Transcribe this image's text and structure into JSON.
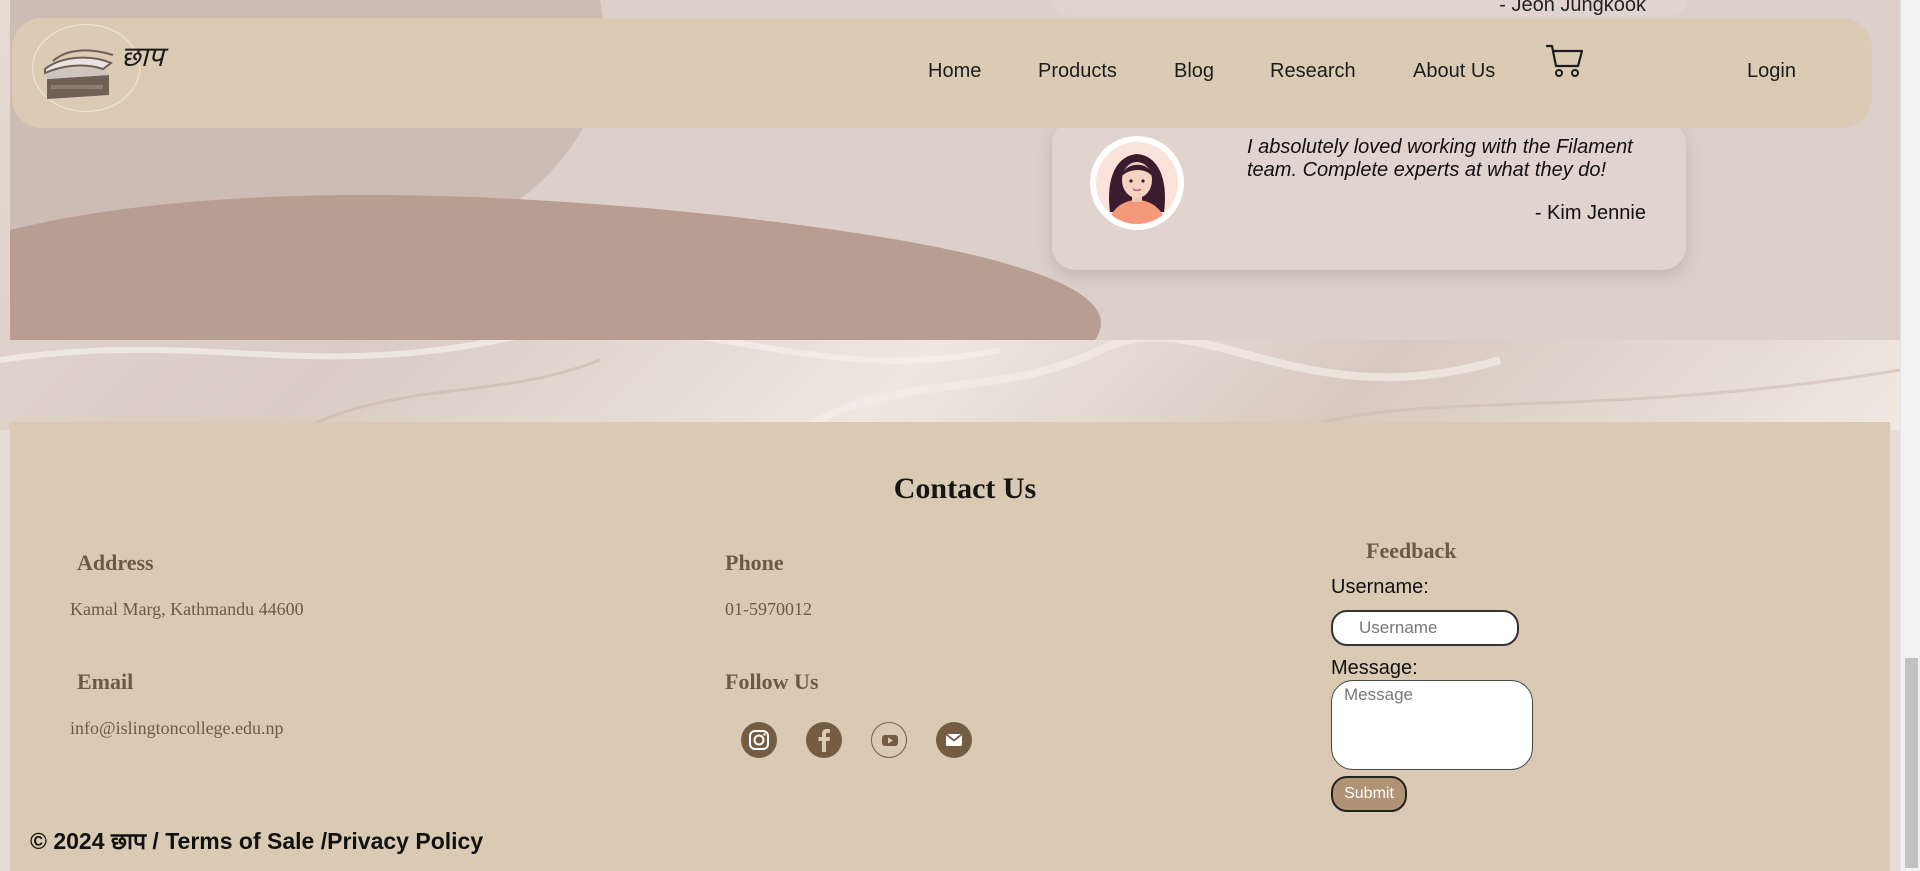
{
  "navbar": {
    "logo_text": "छाप",
    "items": [
      {
        "label": "Home"
      },
      {
        "label": "Products"
      },
      {
        "label": "Blog"
      },
      {
        "label": "Research"
      },
      {
        "label": "About Us"
      }
    ],
    "cart_icon": "cart-icon",
    "login_label": "Login"
  },
  "testimonials": [
    {
      "author": "- Jeon Jungkook"
    },
    {
      "quote": "I absolutely loved working with the Filament team. Complete experts at what they do!",
      "author": "- Kim Jennie"
    }
  ],
  "contact": {
    "title": "Contact Us",
    "address_heading": "Address",
    "address_value": "Kamal Marg, Kathmandu 44600",
    "phone_heading": "Phone",
    "phone_value": "01-5970012",
    "email_heading": "Email",
    "email_value": "info@islingtoncollege.edu.np",
    "follow_heading": "Follow Us",
    "social_icons": [
      "instagram-icon",
      "facebook-icon",
      "youtube-icon",
      "mail-icon"
    ],
    "feedback": {
      "heading": "Feedback",
      "username_label": "Username:",
      "username_placeholder": "Username",
      "message_label": "Message:",
      "message_placeholder": "Message",
      "submit_label": "Submit"
    }
  },
  "footer": {
    "text": "© 2024 छाप / Terms of Sale /Privacy Policy"
  },
  "colors": {
    "navbar_bg": "#dbcbb4",
    "contact_bg": "#dacab3",
    "heading_brown": "#6e5a44",
    "social_bg": "#735c42",
    "submit_bg": "#b09274"
  }
}
